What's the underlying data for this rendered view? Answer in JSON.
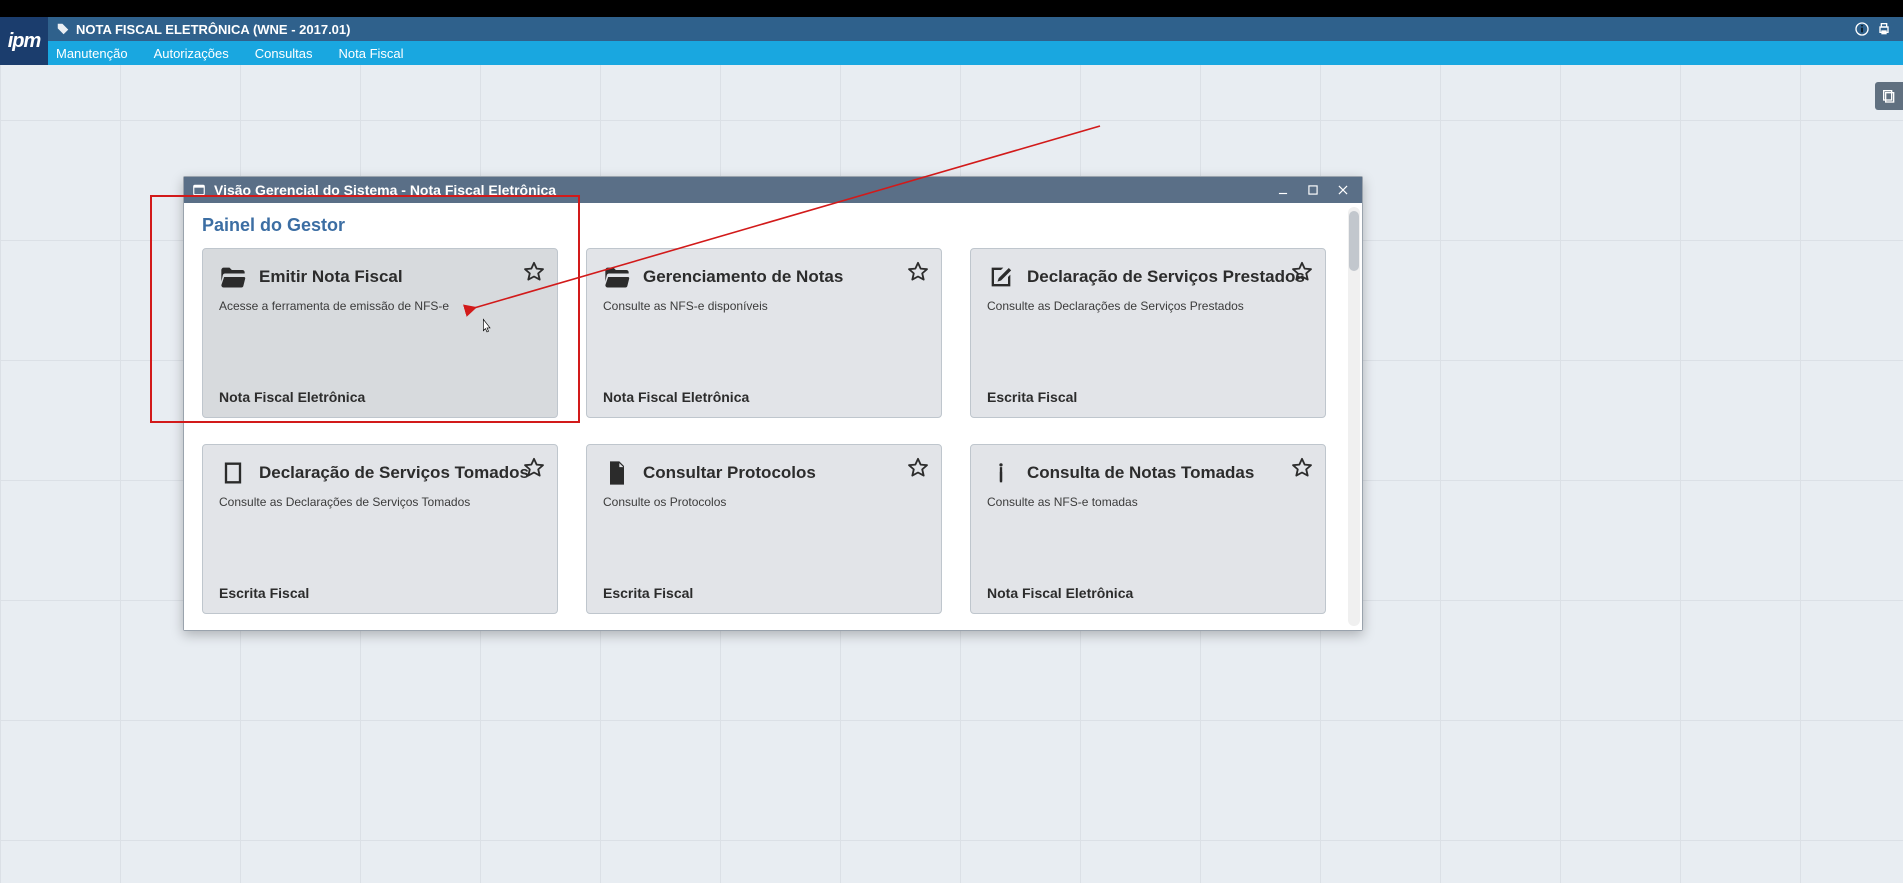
{
  "app": {
    "logo_text": "ipm",
    "title": "NOTA FISCAL ELETRÔNICA (WNE - 2017.01)"
  },
  "menu": {
    "items": [
      {
        "label": "Manutenção"
      },
      {
        "label": "Autorizações"
      },
      {
        "label": "Consultas"
      },
      {
        "label": "Nota Fiscal"
      }
    ]
  },
  "inner_window": {
    "title": "Visão Gerencial do Sistema - Nota Fiscal Eletrônica",
    "panel_title": "Painel do Gestor"
  },
  "cards": [
    {
      "icon": "folder-open",
      "title": "Emitir Nota Fiscal",
      "desc": "Acesse a ferramenta de emissão de NFS-e",
      "footer": "Nota Fiscal Eletrônica",
      "hover": true
    },
    {
      "icon": "folder-open",
      "title": "Gerenciamento de Notas",
      "desc": "Consulte as NFS-e disponíveis",
      "footer": "Nota Fiscal Eletrônica",
      "hover": false
    },
    {
      "icon": "edit-square",
      "title": "Declaração de Serviços Prestados",
      "desc": "Consulte as Declarações de Serviços Prestados",
      "footer": "Escrita Fiscal",
      "hover": false
    },
    {
      "icon": "note",
      "title": "Declaração de Serviços Tomados",
      "desc": "Consulte as Declarações de Serviços Tomados",
      "footer": "Escrita Fiscal",
      "hover": false
    },
    {
      "icon": "file-text",
      "title": "Consultar Protocolos",
      "desc": "Consulte os Protocolos",
      "footer": "Escrita Fiscal",
      "hover": false
    },
    {
      "icon": "info",
      "title": "Consulta de Notas Tomadas",
      "desc": "Consulte as NFS-e tomadas",
      "footer": "Nota Fiscal Eletrônica",
      "hover": false
    }
  ]
}
